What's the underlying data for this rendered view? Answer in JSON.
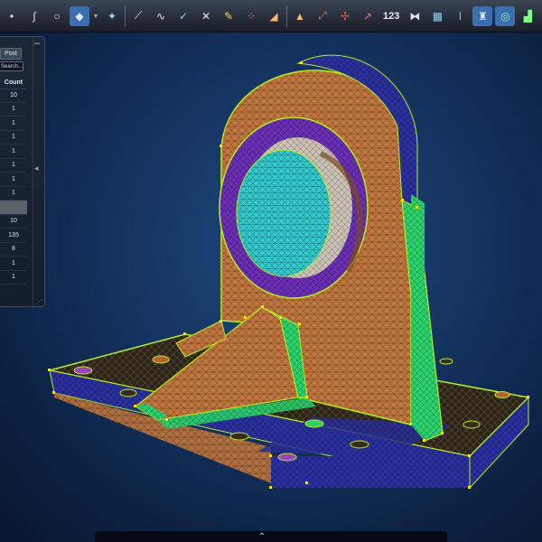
{
  "panel": {
    "minimize": "–",
    "tab_label": "Post",
    "search_text": "Search...",
    "column_header": "Count",
    "rows": [
      "10",
      "1",
      "1",
      "1",
      "1",
      "1",
      "1",
      "1",
      "",
      "10",
      "135",
      "8",
      "1",
      "1"
    ],
    "collapse": "◂",
    "resize": "⋰"
  },
  "toolbar": {
    "count_label": "123"
  },
  "bottom": {
    "handle": "⌃"
  },
  "colors": {
    "background": "#163766",
    "mesh_orange": "#c0773f",
    "mesh_purple": "#6a2fb0",
    "mesh_cyan": "#36c8cc",
    "mesh_green": "#2ccf6a",
    "mesh_navy": "#2a2f9a",
    "edge_lime": "#b4f020",
    "node_yellow": "#ffe000"
  }
}
